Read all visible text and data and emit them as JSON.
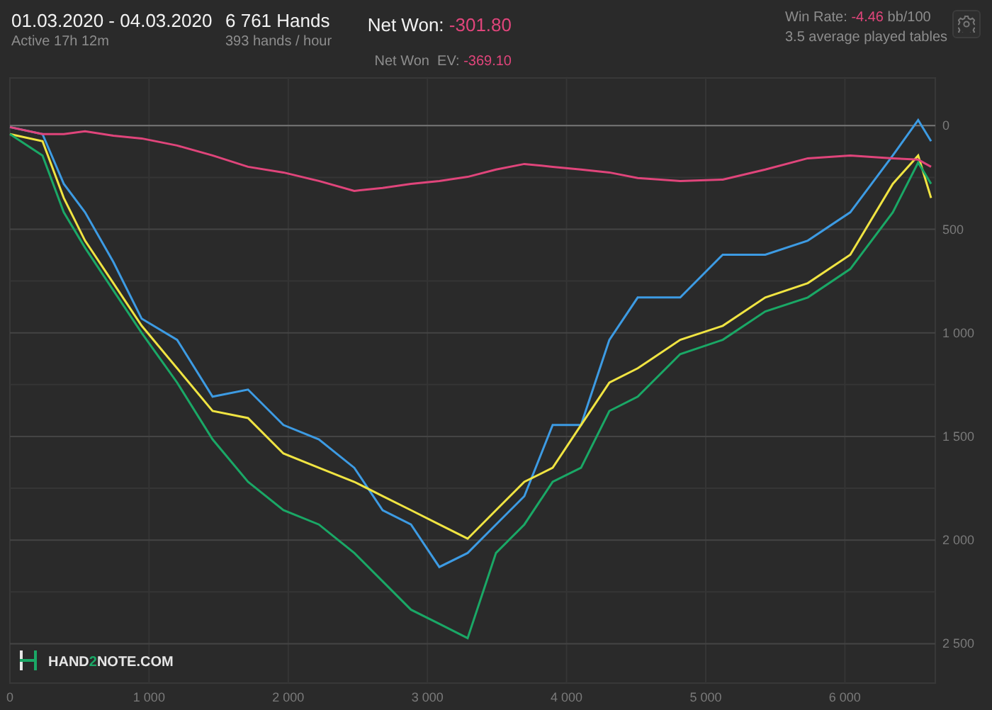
{
  "header": {
    "date_range": "01.03.2020 - 04.03.2020",
    "active": "Active 17h 12m",
    "hands": "6 761 Hands",
    "hands_rate": "393 hands / hour",
    "net_won_label": "Net Won:",
    "net_won": "-301.80",
    "net_won_ev_label": "Net Won  EV:",
    "net_won_ev": "-369.10",
    "win_rate_label": "Win Rate:",
    "win_rate": "-4.46",
    "win_rate_unit": "bb/100",
    "tables": "3.5 average played tables"
  },
  "logo": {
    "parts": [
      "HAND",
      "2",
      "NOTE.COM"
    ]
  },
  "chart_data": {
    "type": "line",
    "x": [
      0,
      234,
      387,
      540,
      743,
      947,
      1202,
      1456,
      1711,
      1965,
      2220,
      2475,
      2678,
      2882,
      3086,
      3289,
      3493,
      3697,
      3900,
      4104,
      4308,
      4511,
      4817,
      5122,
      5428,
      5733,
      6039,
      6344,
      6527,
      6619
    ],
    "series": [
      {
        "color": "#3d9be3",
        "values": [
          -7,
          -41,
          -281,
          -418,
          -658,
          -932,
          -1034,
          -1308,
          -1274,
          -1445,
          -1514,
          -1651,
          -1856,
          -1925,
          -2130,
          -2062,
          -1925,
          -1788,
          -1445,
          -1445,
          -1034,
          -829,
          -829,
          -623,
          -623,
          -555,
          -418,
          -144,
          27,
          -75
        ]
      },
      {
        "color": "#f0e442",
        "values": [
          -41,
          -75,
          -349,
          -555,
          -760,
          -966,
          -1171,
          -1377,
          -1411,
          -1582,
          -1651,
          -1719,
          -1788,
          -1856,
          -1925,
          -1993,
          -1856,
          -1719,
          -1651,
          -1445,
          -1240,
          -1171,
          -1034,
          -966,
          -829,
          -760,
          -623,
          -281,
          -144,
          -349
        ]
      },
      {
        "color": "#1aa866",
        "values": [
          -41,
          -144,
          -418,
          -589,
          -795,
          -1000,
          -1240,
          -1514,
          -1719,
          -1856,
          -1925,
          -2062,
          -2199,
          -2336,
          -2404,
          -2473,
          -2062,
          -1925,
          -1719,
          -1651,
          -1377,
          -1308,
          -1103,
          -1034,
          -897,
          -829,
          -692,
          -418,
          -178,
          -281
        ]
      },
      {
        "color": "#e0457b",
        "values": [
          -7,
          -41,
          -41,
          -27,
          -48,
          -62,
          -96,
          -144,
          -199,
          -226,
          -267,
          -315,
          -301,
          -281,
          -267,
          -247,
          -212,
          -185,
          -199,
          -212,
          -226,
          -253,
          -267,
          -260,
          -212,
          -158,
          -144,
          -158,
          -164,
          -199
        ]
      }
    ],
    "grid": true,
    "xlim": [
      0,
      6650
    ],
    "ylim": [
      -2690,
      230
    ],
    "xticks": [
      {
        "value": 0,
        "label": "0"
      },
      {
        "value": 1000,
        "label": "1 000"
      },
      {
        "value": 2000,
        "label": "2 000"
      },
      {
        "value": 3000,
        "label": "3 000"
      },
      {
        "value": 4000,
        "label": "4 000"
      },
      {
        "value": 5000,
        "label": "5 000"
      },
      {
        "value": 6000,
        "label": "6 000"
      }
    ],
    "yticks": [
      {
        "value": 0,
        "label": "0"
      },
      {
        "value": -500,
        "label": "500"
      },
      {
        "value": -1000,
        "label": "1 000"
      },
      {
        "value": -1500,
        "label": "1 500"
      },
      {
        "value": -2000,
        "label": "2 000"
      },
      {
        "value": -2500,
        "label": "2 500"
      }
    ]
  }
}
